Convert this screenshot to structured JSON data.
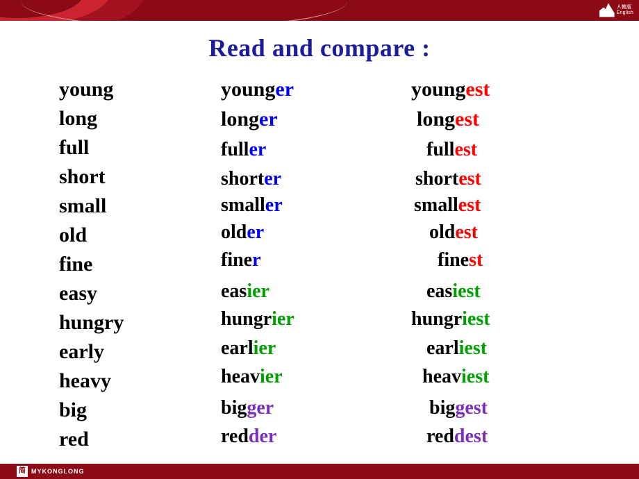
{
  "slide": {
    "title": "Read and compare :",
    "title_color": "#1D1D9C",
    "bar_color": "#8C0A16"
  },
  "branding": {
    "top_logo_line1": "人教版",
    "top_logo_line2": "English",
    "bottom_logo_mark": "简",
    "bottom_logo_text": "MYKONGLONG"
  },
  "colors": {
    "red": "#FF0000",
    "blue": "#0000FF",
    "green": "#00A000",
    "purple": "#7B2FBE",
    "black": "#000000"
  },
  "table": {
    "rows": [
      {
        "base": "young",
        "comparative_stem": "young",
        "comparative_suffix": "er",
        "comparative_suffix_color": "blue",
        "superlative_stem": "young",
        "superlative_suffix": "est",
        "superlative_suffix_color": "red"
      },
      {
        "base": "long",
        "comparative_stem": "long",
        "comparative_suffix": "er",
        "comparative_suffix_color": "blue",
        "superlative_stem": "long",
        "superlative_suffix": "est",
        "superlative_suffix_color": "red"
      },
      {
        "base": "full",
        "comparative_stem": "full",
        "comparative_suffix": "er",
        "comparative_suffix_color": "blue",
        "superlative_stem": "full",
        "superlative_suffix": "est",
        "superlative_suffix_color": "red"
      },
      {
        "base": "short",
        "comparative_stem": "short",
        "comparative_suffix": "er",
        "comparative_suffix_color": "blue",
        "superlative_stem": "short",
        "superlative_suffix": "est",
        "superlative_suffix_color": "red"
      },
      {
        "base": "small",
        "comparative_stem": "small",
        "comparative_suffix": "er",
        "comparative_suffix_color": "blue",
        "superlative_stem": "small",
        "superlative_suffix": "est",
        "superlative_suffix_color": "red"
      },
      {
        "base": "old",
        "comparative_stem": "old",
        "comparative_suffix": "er",
        "comparative_suffix_color": "blue",
        "superlative_stem": "old",
        "superlative_suffix": "est",
        "superlative_suffix_color": "red"
      },
      {
        "base": "fine",
        "comparative_stem": "fine",
        "comparative_suffix": "r",
        "comparative_suffix_color": "blue",
        "superlative_stem": "fine",
        "superlative_suffix": "st",
        "superlative_suffix_color": "red"
      },
      {
        "base": "easy",
        "comparative_stem": "eas",
        "comparative_suffix": "ier",
        "comparative_suffix_color": "green",
        "superlative_stem": "eas",
        "superlative_suffix": "iest",
        "superlative_suffix_color": "green"
      },
      {
        "base": "hungry",
        "comparative_stem": "hungr",
        "comparative_suffix": "ier",
        "comparative_suffix_color": "green",
        "superlative_stem": "hungr",
        "superlative_suffix": "iest",
        "superlative_suffix_color": "green"
      },
      {
        "base": "early",
        "comparative_stem": "earl",
        "comparative_suffix": "ier",
        "comparative_suffix_color": "green",
        "superlative_stem": "earl",
        "superlative_suffix": "iest",
        "superlative_suffix_color": "green"
      },
      {
        "base": "heavy",
        "comparative_stem": "heav",
        "comparative_suffix": "ier",
        "comparative_suffix_color": "green",
        "superlative_stem": "heav",
        "superlative_suffix": "iest",
        "superlative_suffix_color": "green"
      },
      {
        "base": "big",
        "comparative_stem": "big",
        "comparative_suffix": "ger",
        "comparative_suffix_color": "purple",
        "superlative_stem": "big",
        "superlative_suffix": "gest",
        "superlative_suffix_color": "purple"
      },
      {
        "base": "red",
        "comparative_stem": "red",
        "comparative_suffix": "der",
        "comparative_suffix_color": "purple",
        "superlative_stem": "red",
        "superlative_suffix": "dest",
        "superlative_suffix_color": "purple"
      }
    ]
  }
}
